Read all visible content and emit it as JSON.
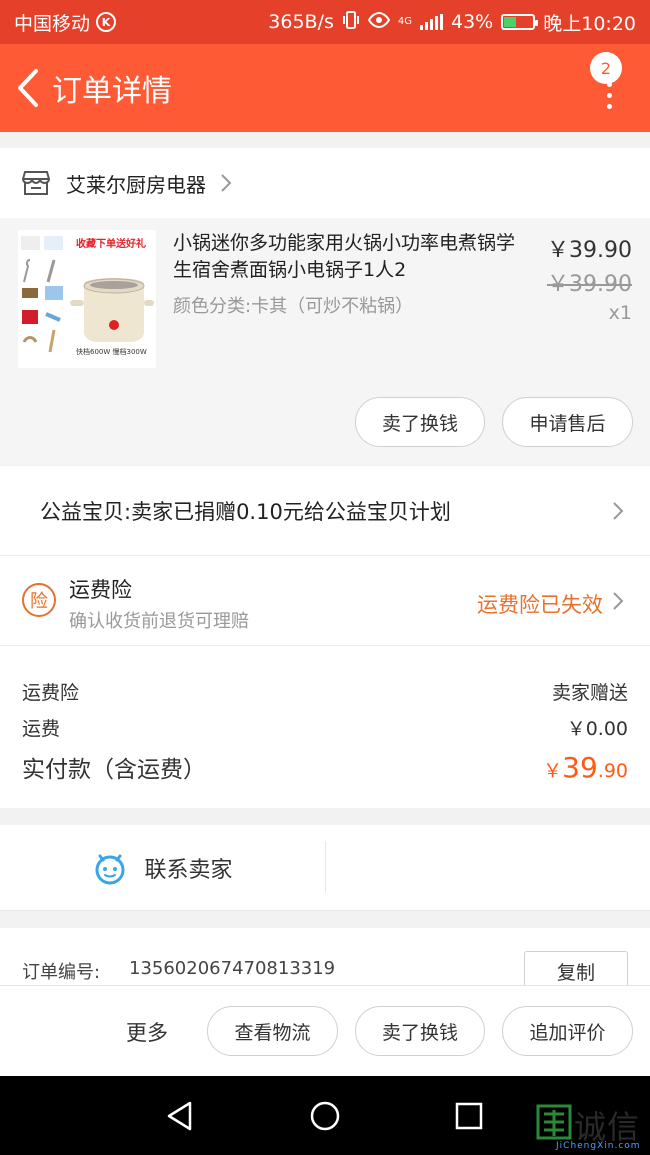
{
  "status_bar": {
    "carrier": "中国移动",
    "k_badge": "K",
    "net_speed": "365B/s",
    "network": "4G",
    "battery": "43%",
    "battery_level": 0.43,
    "time": "晚上10:20"
  },
  "nav": {
    "title": "订单详情",
    "badge_count": "2",
    "back_icon": "chevron-left-icon",
    "more_icon": "more-vertical-icon"
  },
  "shop": {
    "name": "艾莱尔厨房电器",
    "icon": "store-icon"
  },
  "product": {
    "title": "小锅迷你多功能家用火锅小功率电煮锅学生宿舍煮面锅小电锅子1人2",
    "spec": "颜色分类:卡其（可炒不粘锅）",
    "price": "￥39.90",
    "original_price": "￥39.90",
    "quantity": "x1",
    "image_text": {
      "promo": "收藏下单送好礼",
      "power": "快档600W  慢档300W"
    },
    "actions": [
      "卖了换钱",
      "申请售后"
    ]
  },
  "charity": {
    "text": "公益宝贝:卖家已捐赠0.10元给公益宝贝计划"
  },
  "insurance": {
    "icon_label": "险",
    "title": "运费险",
    "subtitle": "确认收货前退货可理赔",
    "status": "运费险已失效"
  },
  "fees": {
    "insurance_label": "运费险",
    "insurance_value": "卖家赠送",
    "shipping_label": "运费",
    "shipping_value": "￥0.00",
    "total_label": "实付款（含运费）",
    "total_currency": "￥",
    "total_int": "39",
    "total_dec": ".90"
  },
  "contact": {
    "label": "联系卖家",
    "icon": "chat-face-icon"
  },
  "order": {
    "number_label": "订单编号:",
    "number": "135602067470813319",
    "copy_label": "复制"
  },
  "action_bar": {
    "more_label": "更多",
    "buttons": [
      "查看物流",
      "卖了换钱",
      "追加评价"
    ]
  },
  "watermark": {
    "brand": "诚信",
    "url": "JiChengXin.com"
  },
  "colors": {
    "nav_bg": "#ff5a36",
    "status_bg": "#e5402a",
    "accent_orange": "#e8712b",
    "price_orange": "#ff5a14",
    "contact_blue": "#3aa5e8"
  }
}
